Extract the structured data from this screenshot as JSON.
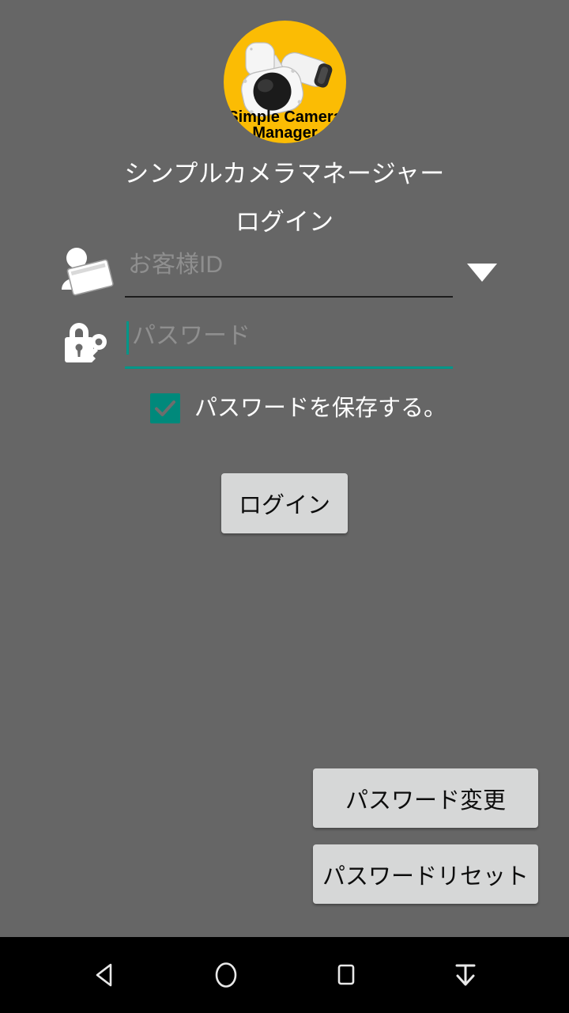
{
  "app": {
    "title": "シンプルカメラマネージャー",
    "logo": {
      "line1": "Simple Camera",
      "line2": "Manager",
      "background_color": "#fbbc04",
      "icon_name": "security-cameras-logo"
    },
    "background_color": "#666666"
  },
  "form": {
    "heading": "ログイン",
    "customer_id": {
      "placeholder": "お客様ID",
      "value": "",
      "icon_name": "id-card-person-icon",
      "underline_color": "#1c1c1c",
      "dropdown_icon_name": "chevron-down-icon"
    },
    "password": {
      "placeholder": "パスワード",
      "value": "",
      "icon_name": "lock-key-icon",
      "focused": true,
      "underline_color": "#009688"
    },
    "save_password": {
      "label": "パスワードを保存する。",
      "checked": true,
      "accent_color": "#00897b"
    },
    "login_button": "ログイン"
  },
  "actions": {
    "change_password": "パスワード変更",
    "reset_password": "パスワードリセット",
    "button_color": "#d6d7d7"
  },
  "navbar": {
    "background_color": "#000000",
    "items": [
      {
        "name": "back",
        "icon_name": "triangle-back-icon"
      },
      {
        "name": "home",
        "icon_name": "circle-home-icon"
      },
      {
        "name": "recents",
        "icon_name": "square-recents-icon"
      },
      {
        "name": "hide-keyboard",
        "icon_name": "hide-keyboard-icon"
      }
    ]
  }
}
